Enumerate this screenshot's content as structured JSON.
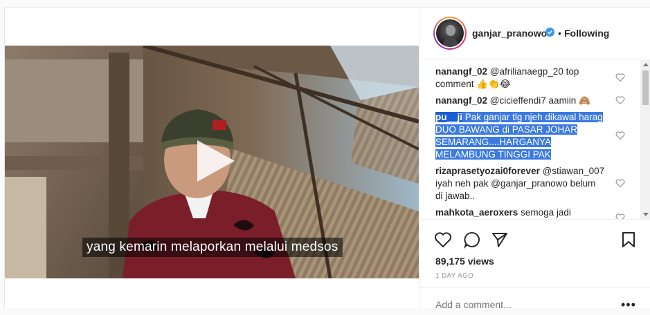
{
  "post": {
    "subtitle": "yang kemarin melaporkan melalui medsos"
  },
  "header": {
    "username": "ganjar_pranowo",
    "separator": "•",
    "follow_status": "Following"
  },
  "comments": [
    {
      "user": "nanangf_02",
      "text": "@afrilianaegp_20 top comment 👍👏😂",
      "line1": "@afrilianaegp_20 top",
      "line2": "comment 👍👏😂"
    },
    {
      "user": "nanangf_02",
      "text": "@cicieffendi7 aamiin 🙈"
    },
    {
      "user": "pu__ji",
      "line1": "Pak ganjar tlg njeh dikawal harag",
      "line2": "DUO BAWANG di PASAR JOHAR",
      "line3": "SEMARANG....HARGANYA",
      "line4": "MELAMBUNG TINGGI PAK"
    },
    {
      "user": "rizaprasetyozai0forever",
      "line1": "@stiawan_007",
      "line2": "iyah neh pak @ganjar_pranowo belum",
      "line3": "di jawab.."
    },
    {
      "user": "mahkota_aeroxers",
      "text": "semoga jadi"
    }
  ],
  "stats": {
    "views": "89,175 views",
    "time_ago": "1 DAY AGO"
  },
  "add_comment": {
    "placeholder": "Add a comment...",
    "more": "•••"
  },
  "icons": [
    "play-icon",
    "verified-icon",
    "heart-icon",
    "comment-icon",
    "share-icon",
    "bookmark-icon",
    "more-options-icon"
  ],
  "colors": {
    "selection": "#3b7ae0",
    "verified": "#3897f0",
    "text": "#262626",
    "muted": "#999999"
  }
}
